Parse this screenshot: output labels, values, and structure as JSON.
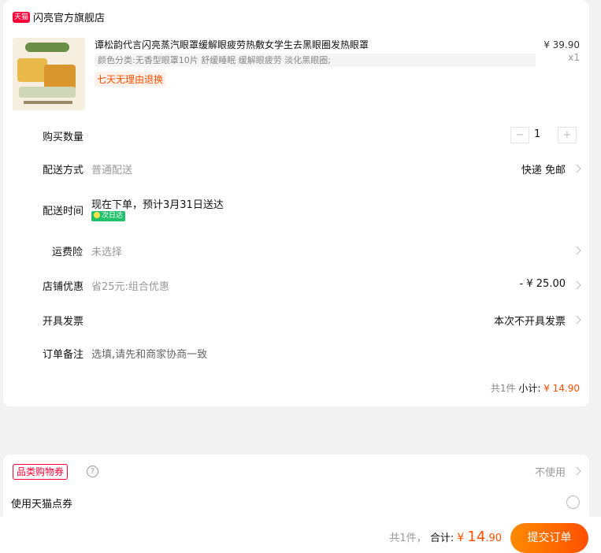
{
  "store": {
    "badge": "天猫",
    "name": "闪亮官方旗舰店"
  },
  "product": {
    "title": "谭松韵代言闪亮蒸汽眼罩缓解眼疲劳热敷女学生去黑眼圈发热眼罩",
    "sku": "颜色分类:无香型眼罩10片 舒缓睡眠 缓解眼疲劳 淡化黑眼圈;",
    "return_tag": "七天无理由退换",
    "price": "¥ 39.90",
    "qty": "x1"
  },
  "rows": {
    "quantity": {
      "label": "购买数量",
      "value": "1",
      "minus": "−",
      "plus": "+"
    },
    "shipping": {
      "label": "配送方式",
      "value": "普通配送",
      "right": "快递 免邮"
    },
    "delivery": {
      "label": "配送时间",
      "value": "现在下单，预计3月31日送达",
      "badge": "次日达"
    },
    "insurance": {
      "label": "运费险",
      "value": "未选择"
    },
    "store_discount": {
      "label": "店铺优惠",
      "value": "省25元:组合优惠",
      "right": "- ¥ 25.00"
    },
    "invoice": {
      "label": "开具发票",
      "right": "本次不开具发票"
    },
    "note": {
      "label": "订单备注",
      "placeholder": "选填,请先和商家协商一致"
    }
  },
  "subtotal": {
    "count": "共1件",
    "label": "小计:",
    "amount": "¥ 14.90"
  },
  "coupons": {
    "category_tag": "品类购物券",
    "help": "?",
    "category_value": "不使用",
    "points_label": "使用天猫点券"
  },
  "footer": {
    "count": "共1件，",
    "total_label": "合计:",
    "currency": "¥",
    "amount_int": "14",
    "amount_dec": ".90",
    "submit_label": "提交订单"
  },
  "colors": {
    "accent": "#ff5000",
    "tmall_red": "#ff0036",
    "next_day_green": "#21c06b"
  }
}
